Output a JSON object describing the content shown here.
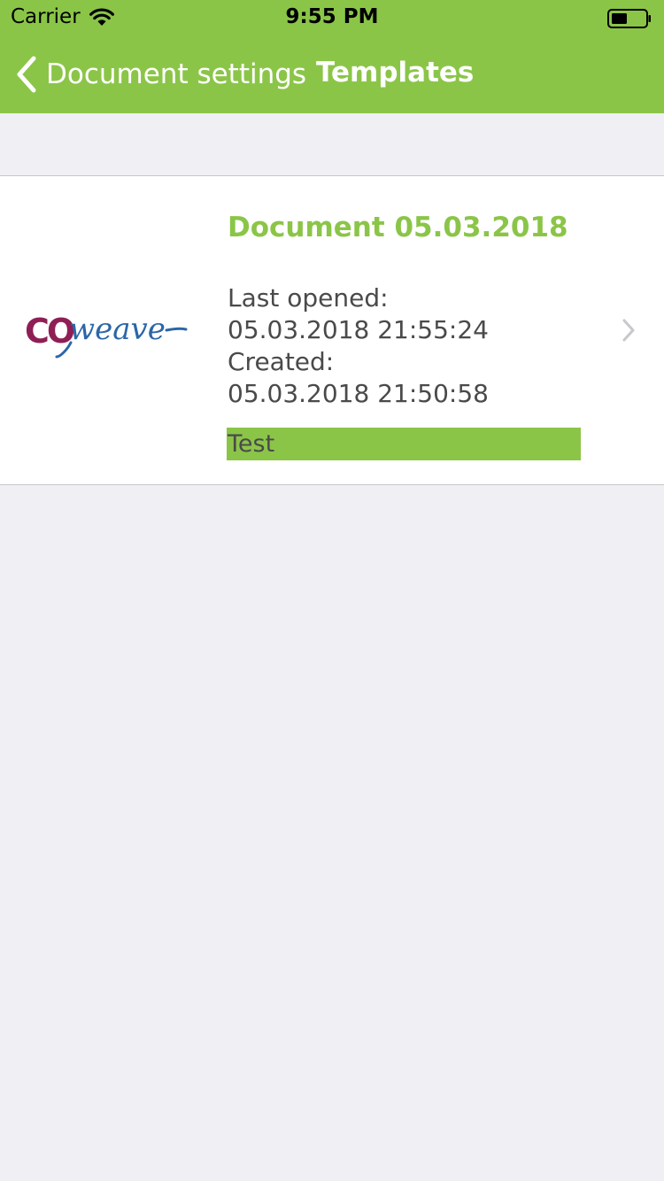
{
  "status_bar": {
    "carrier": "Carrier",
    "time": "9:55 PM"
  },
  "nav": {
    "back_label": "Document settings",
    "title": "Templates"
  },
  "colors": {
    "accent_green": "#8bc548",
    "background": "#efeff4",
    "text_gray": "#4a4a4a"
  },
  "document": {
    "title": "Document 05.03.2018",
    "last_opened_label": "Last opened:",
    "last_opened_value": "05.03.2018 21:55:24",
    "created_label": "Created:",
    "created_value": "05.03.2018 21:50:58",
    "tag": "Test",
    "logo_text_co": "CO",
    "logo_text_weave": "weave"
  },
  "icons": {
    "back": "chevron-left-icon",
    "disclosure": "chevron-right-icon",
    "wifi": "wifi-icon",
    "battery": "battery-icon"
  }
}
